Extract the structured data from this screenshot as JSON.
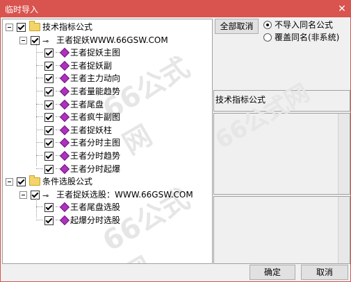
{
  "window": {
    "title": "临时导入",
    "close_glyph": "✕"
  },
  "tree": {
    "groups": [
      {
        "label": "技术指标公式",
        "source": "王者捉妖WWW.66GSW.COM",
        "items": [
          "王者捉妖主图",
          "王者捉妖副",
          "王者主力动向",
          "王者量能趋势",
          "王者尾盘",
          "王者疯牛副图",
          "王者捉妖柱",
          "王者分时主图",
          "王者分时趋势",
          "王者分时起爆"
        ]
      },
      {
        "label": "条件选股公式",
        "source": "王者捉妖选股：WWW.66GSW.COM",
        "items": [
          "王者尾盘选股",
          "起爆分时选股"
        ]
      }
    ]
  },
  "controls": {
    "cancel_all_label": "全部取消",
    "radio_skip_label": "不导入同名公式",
    "radio_overwrite_label": "覆盖同名(非系统)",
    "selected_option": "不导入同名公式"
  },
  "info": {
    "category_label": "技术指标公式"
  },
  "footer": {
    "ok_label": "确定",
    "cancel_label": "取消"
  },
  "colors": {
    "titlebar": "#d9534f",
    "gem": "#b030c0",
    "folder": "#f3d46a"
  },
  "watermark": "66公式网"
}
